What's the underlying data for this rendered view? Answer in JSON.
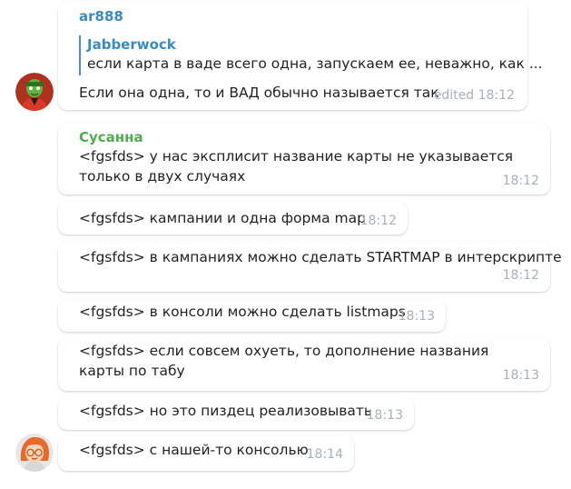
{
  "group1": {
    "sender": "ar888",
    "sender_color": "#3a8bc0",
    "reply": {
      "name": "Jabberwock",
      "text": "если карта в ваде всего одна, запускаем ее, неважно, как ..."
    },
    "text": "Если она одна, то и ВАД обычно называется так",
    "time": "edited 18:12"
  },
  "group2": {
    "sender": "Сусанна",
    "sender_color": "#4fae4e",
    "messages": [
      {
        "text": "<fgsfds> у нас эксплисит название карты не указывается только в двух случаях",
        "time": "18:12"
      },
      {
        "text": "<fgsfds> кампании и одна форма map",
        "time": "18:12"
      },
      {
        "text": "<fgsfds> в кампаниях можно сделать STARTMAP в интерскрипте",
        "time": "18:12"
      },
      {
        "text": "<fgsfds> в консоли можно сделать listmaps",
        "time": "18:13"
      },
      {
        "text": "<fgsfds> если совсем охуеть, то дополнение названия карты по табу",
        "time": "18:13"
      },
      {
        "text": "<fgsfds> но это пиздец реализовывать",
        "time": "18:13"
      },
      {
        "text": "<fgsfds> с нашей-то консолью",
        "time": "18:14"
      }
    ]
  }
}
